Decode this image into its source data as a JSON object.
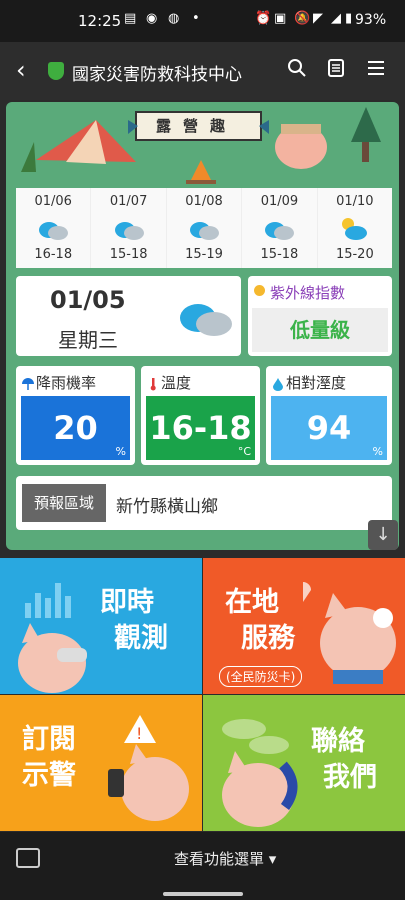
{
  "status": {
    "time": "12:25",
    "battery": "93%"
  },
  "appbar": {
    "title": "國家災害防救科技中心"
  },
  "banner": {
    "title": "露營趣"
  },
  "forecast": [
    {
      "date": "01/06",
      "range": "16-18",
      "icon": "cloudy-icon"
    },
    {
      "date": "01/07",
      "range": "15-18",
      "icon": "cloudy-icon"
    },
    {
      "date": "01/08",
      "range": "15-19",
      "icon": "cloudy-icon"
    },
    {
      "date": "01/09",
      "range": "15-18",
      "icon": "cloudy-icon"
    },
    {
      "date": "01/10",
      "range": "15-20",
      "icon": "partly-sunny-icon"
    }
  ],
  "today": {
    "date": "01/05",
    "weekday": "星期三"
  },
  "uv": {
    "label": "紫外線指數",
    "value": "低量級"
  },
  "metrics": {
    "rain": {
      "label": "降雨機率",
      "value": "20",
      "unit": "%",
      "color": "#1a73d9"
    },
    "temp": {
      "label": "溫度",
      "value": "16-18",
      "unit": "°C",
      "color": "#1aa34a"
    },
    "humidity": {
      "label": "相對溼度",
      "value": "94",
      "unit": "%",
      "color": "#4db3f0"
    }
  },
  "area": {
    "tag": "預報區域",
    "place": "新竹縣橫山鄉"
  },
  "tiles": {
    "observe": {
      "line1": "即時",
      "line2": "觀測",
      "color": "#29a8e0"
    },
    "service": {
      "line1": "在地",
      "line2": "服務",
      "sub": "(全民防災卡)",
      "color": "#f05a28"
    },
    "subscribe": {
      "line1": "訂閱",
      "line2": "示警",
      "color": "#f7a11a"
    },
    "contact": {
      "line1": "聯絡",
      "line2": "我們",
      "color": "#8cc63f"
    }
  },
  "bottom": {
    "menu": "查看功能選單 ▾"
  }
}
